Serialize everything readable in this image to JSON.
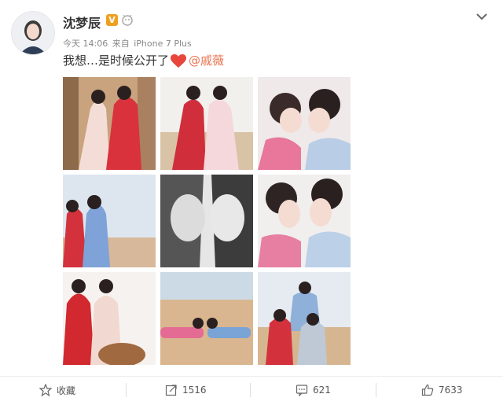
{
  "post": {
    "username": "沈梦辰",
    "v_badge": "V",
    "time": "今天 14:06",
    "source_prefix": "来自",
    "source": "iPhone 7 Plus",
    "text": "我想…是时候公开了",
    "mention": "@戚薇"
  },
  "toolbar": {
    "favorite_label": "收藏",
    "repost_count": "1516",
    "comment_count": "621",
    "like_count": "7633"
  },
  "colors": {
    "mention": "#eb7350",
    "badge": "#f0a020",
    "heart": "#e8453c"
  },
  "icons": [
    "chevron-down-icon",
    "member-icon",
    "heart-emoji-icon",
    "star-icon",
    "repost-icon",
    "comment-icon",
    "like-icon"
  ],
  "photos": [
    "photo-1",
    "photo-2",
    "photo-3",
    "photo-4",
    "photo-5",
    "photo-6",
    "photo-7",
    "photo-8",
    "photo-9"
  ]
}
